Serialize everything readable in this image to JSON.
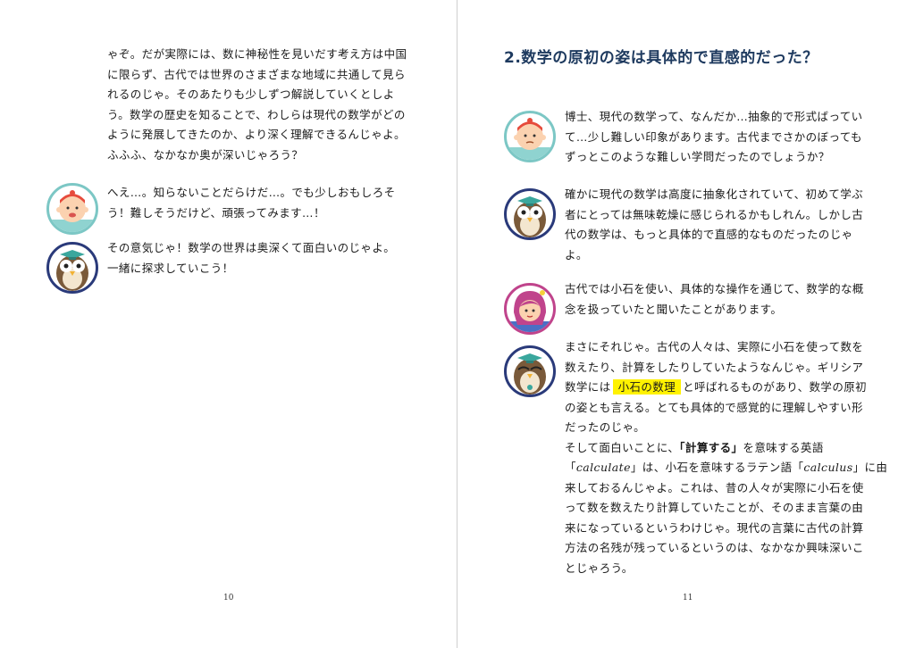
{
  "left": {
    "page_number": "10",
    "intro_lines": [
      "ゃぞ。だが実際には、数に神秘性を見いだす考え方は中国",
      "に限らず、古代では世界のさまざまな地域に共通して見ら",
      "れるのじゃ。そのあたりも少しずつ解説していくとしよ",
      "う。数学の歴史を知ることで、わしらは現代の数学がどの",
      "ように発展してきたのか、より深く理解できるんじゃよ。",
      "ふふふ、なかなか奥が深いじゃろう？"
    ],
    "dialogue_boy": [
      "へえ…。知らないことだらけだ…。でも少しおもしろそ",
      "う！難しそうだけど、頑張ってみます…！"
    ],
    "dialogue_owl": [
      "その意気じゃ！数学の世界は奥深くて面白いのじゃよ。",
      "一緒に探求していこう！"
    ]
  },
  "right": {
    "page_number": "11",
    "heading": "2.数学の原初の姿は具体的で直感的だった？",
    "dialogue_boy": [
      "博士、現代の数学って、なんだか…抽象的で形式ばってい",
      "て…少し難しい印象があります。古代までさかのぼっても",
      "ずっとこのような難しい学問だったのでしょうか？"
    ],
    "dialogue_owl_1": [
      "確かに現代の数学は高度に抽象化されていて、初めて学ぶ",
      "者にとっては無味乾燥に感じられるかもしれん。しかし古",
      "代の数学は、もっと具体的で直感的なものだったのじゃ",
      "よ。"
    ],
    "dialogue_girl": [
      "古代では小石を使い、具体的な操作を通じて、数学的な概",
      "念を扱っていたと聞いたことがあります。"
    ],
    "owl2": {
      "l1": "まさにそれじゃ。古代の人々は、実際に小石を使って数を",
      "l2": "数えたり、計算をしたりしていたようなんじゃ。ギリシア",
      "l3_pre": "数学には",
      "l3_hl": "小石の数理",
      "l3_post": "と呼ばれるものがあり、数学の原初",
      "l4": "の姿とも言える。とても具体的で感覚的に理解しやすい形",
      "l5": "だったのじゃ。",
      "l6_pre": "そして面白いことに、",
      "l6_bold": "「計算する」",
      "l6_post": "を意味する英語",
      "l7_q1": "「",
      "l7_calc": "calculate",
      "l7_mid": "」は、小石を意味するラテン語「",
      "l7_calc2": "calculus",
      "l7_post": "」に由",
      "l8": "来しておるんじゃよ。これは、昔の人々が実際に小石を使",
      "l9": "って数を数えたり計算していたことが、そのまま言葉の由",
      "l10": "来になっているというわけじゃ。現代の言葉に古代の計算",
      "l11": "方法の名残が残っているというのは、なかなか興味深いこ",
      "l12": "とじゃろう。"
    }
  },
  "colors": {
    "heading": "#1e3a5f",
    "highlight": "#fff200",
    "avatar_boy_ring": "#7cc7c5",
    "avatar_owl_ring": "#2a3a7a",
    "avatar_girl_ring": "#c0448c"
  }
}
